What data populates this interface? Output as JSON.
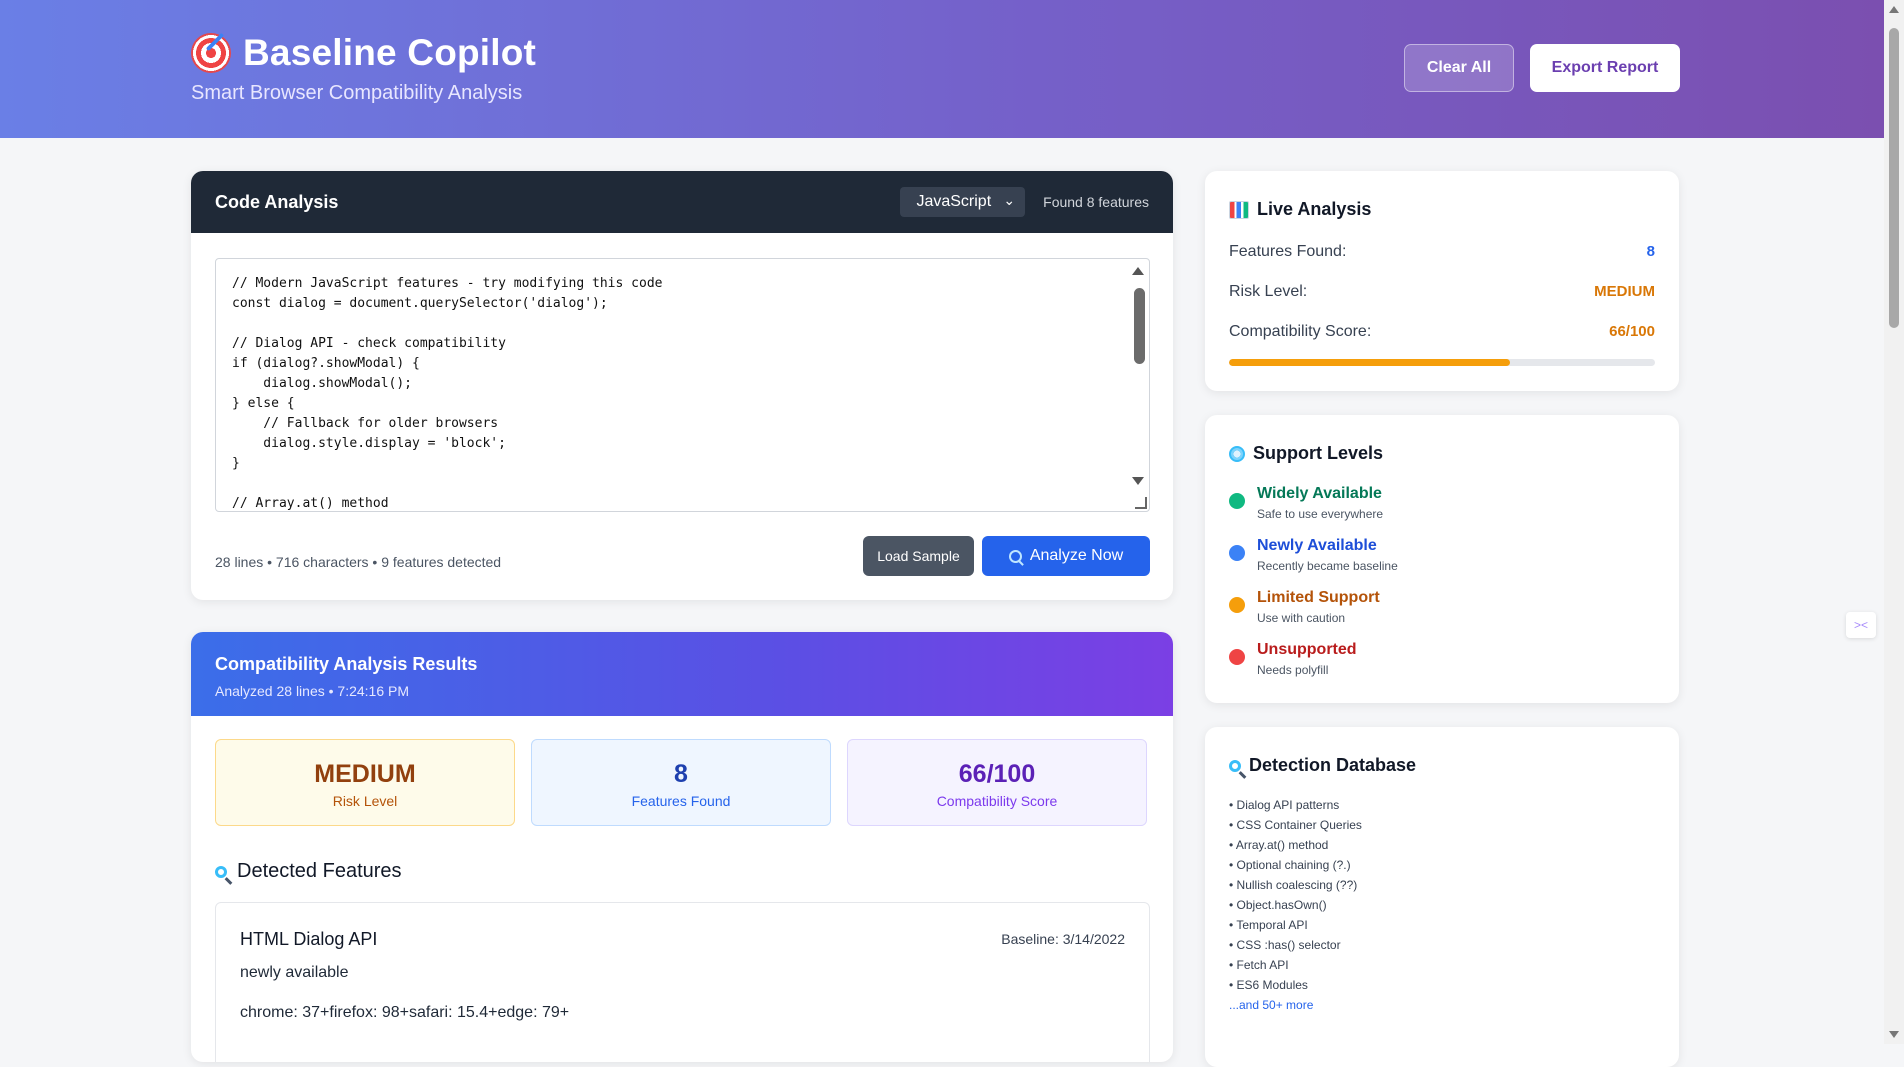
{
  "header": {
    "title": "Baseline Copilot",
    "subtitle": "Smart Browser Compatibility Analysis",
    "clear_label": "Clear All",
    "export_label": "Export Report"
  },
  "code_analysis": {
    "title": "Code Analysis",
    "language": "JavaScript",
    "found_label": "Found 8 features",
    "code": "// Modern JavaScript features - try modifying this code\nconst dialog = document.querySelector('dialog');\n\n// Dialog API - check compatibility\nif (dialog?.showModal) {\n    dialog.showModal();\n} else {\n    // Fallback for older browsers\n    dialog.style.display = 'block';\n}\n\n// Array.at() method",
    "stats": "28 lines • 716 characters • 9 features detected",
    "load_sample_label": "Load Sample",
    "analyze_label": "Analyze Now"
  },
  "results": {
    "title": "Compatibility Analysis Results",
    "subtitle": "Analyzed 28 lines • 7:24:16 PM",
    "metrics": [
      {
        "value": "MEDIUM",
        "label": "Risk Level"
      },
      {
        "value": "8",
        "label": "Features Found"
      },
      {
        "value": "66/100",
        "label": "Compatibility Score"
      }
    ],
    "detected_title": "Detected Features",
    "feature": {
      "name": "HTML Dialog API",
      "baseline": "Baseline: 3/14/2022",
      "status": "newly available",
      "browsers": "chrome: 37+firefox: 98+safari: 15.4+edge: 79+"
    }
  },
  "live": {
    "title": "Live Analysis",
    "features_label": "Features Found:",
    "features_value": "8",
    "risk_label": "Risk Level:",
    "risk_value": "MEDIUM",
    "score_label": "Compatibility Score:",
    "score_value": "66/100",
    "score_fraction": 0.66,
    "colors": {
      "features": "#2563eb",
      "risk": "#d97706",
      "score": "#d97706",
      "bar": "#f59e0b"
    }
  },
  "support": {
    "title": "Support Levels",
    "levels": [
      {
        "name": "Widely Available",
        "desc": "Safe to use everywhere",
        "color": "#10b981",
        "text_color": "#047857"
      },
      {
        "name": "Newly Available",
        "desc": "Recently became baseline",
        "color": "#3b82f6",
        "text_color": "#1d4ed8"
      },
      {
        "name": "Limited Support",
        "desc": "Use with caution",
        "color": "#f59e0b",
        "text_color": "#b45309"
      },
      {
        "name": "Unsupported",
        "desc": "Needs polyfill",
        "color": "#ef4444",
        "text_color": "#b91c1c"
      }
    ]
  },
  "database": {
    "title": "Detection Database",
    "items": [
      "• Dialog API patterns",
      "• CSS Container Queries",
      "• Array.at() method",
      "• Optional chaining (?.)",
      "• Nullish coalescing (??)",
      "• Object.hasOwn()",
      "• Temporal API",
      "• CSS :has() selector",
      "• Fetch API",
      "• ES6 Modules"
    ],
    "more": "...and 50+ more"
  },
  "icons": {
    "brand": "target-icon",
    "live": "bar-chart-icon",
    "support": "globe-icon",
    "database": "magnifier-icon"
  }
}
